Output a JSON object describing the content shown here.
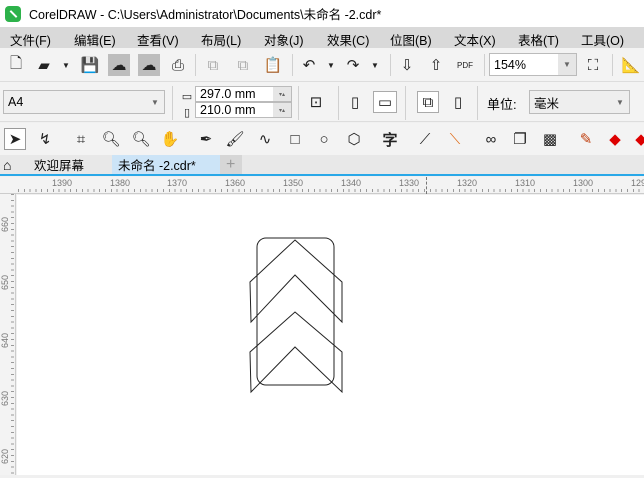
{
  "window": {
    "title": "CorelDRAW - C:\\Users\\Administrator\\Documents\\未命名 -2.cdr*"
  },
  "menu": [
    "文件(F)",
    "编辑(E)",
    "查看(V)",
    "布局(L)",
    "对象(J)",
    "效果(C)",
    "位图(B)",
    "文本(X)",
    "表格(T)",
    "工具(O)"
  ],
  "toolbar": {
    "pdf_label": "PDF",
    "zoom": "154%"
  },
  "property_bar": {
    "page_size": "A4",
    "width": "297.0 mm",
    "height": "210.0 mm",
    "units_label": "单位:",
    "units": "毫米"
  },
  "toolbox": {
    "text_tool": "字"
  },
  "tabs": [
    {
      "label": "欢迎屏幕"
    },
    {
      "label": "未命名 -2.cdr*",
      "active": true
    }
  ],
  "rulers": {
    "horizontal": [
      "1390",
      "1380",
      "1370",
      "1360",
      "1350",
      "1340",
      "1330",
      "1320",
      "1310",
      "1300",
      "129"
    ],
    "vertical": [
      "660",
      "650",
      "640",
      "630",
      "620"
    ]
  }
}
